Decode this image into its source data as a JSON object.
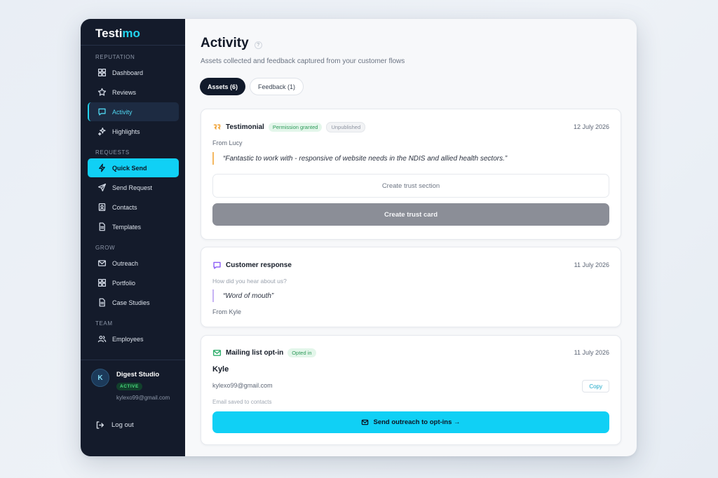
{
  "app": {
    "logo_main": "Testi",
    "logo_accent": "mo"
  },
  "sidebar": {
    "sections": [
      {
        "label": "REPUTATION"
      },
      {
        "label": "REQUESTS"
      },
      {
        "label": "GROW"
      },
      {
        "label": "TEAM"
      }
    ],
    "items": [
      {
        "label": "Dashboard",
        "icon": "grid-icon"
      },
      {
        "label": "Reviews",
        "icon": "star-icon"
      },
      {
        "label": "Activity",
        "icon": "chat-icon"
      },
      {
        "label": "Highlights",
        "icon": "sparkle-icon"
      },
      {
        "label": "Quick Send",
        "icon": "bolt-icon"
      },
      {
        "label": "Send Request",
        "icon": "send-icon"
      },
      {
        "label": "Contacts",
        "icon": "contact-icon"
      },
      {
        "label": "Templates",
        "icon": "document-icon"
      },
      {
        "label": "Outreach",
        "icon": "mail-icon"
      },
      {
        "label": "Portfolio",
        "icon": "grid-icon"
      },
      {
        "label": "Case Studies",
        "icon": "document-icon"
      },
      {
        "label": "Employees",
        "icon": "users-icon"
      }
    ],
    "account": {
      "initial": "K",
      "name": "Digest Studio",
      "badge": "ACTIVE",
      "email": "kylexo99@gmail.com"
    },
    "logout_label": "Log out"
  },
  "main": {
    "title": "Activity",
    "help": "?",
    "subtitle": "Assets collected and feedback captured from your customer flows",
    "tabs": [
      {
        "label": "Assets (6)"
      },
      {
        "label": "Feedback (1)"
      }
    ],
    "cards": {
      "testimonial": {
        "title": "Testimonial",
        "pill_permission": "Permission granted",
        "pill_status": "Unpublished",
        "date": "12 July 2026",
        "from": "From Lucy",
        "quote": "“Fantastic to work with - responsive of website needs in the NDIS and allied health sectors.”",
        "btn_section": "Create trust section",
        "btn_card": "Create trust card"
      },
      "response": {
        "title": "Customer response",
        "date": "11 July 2026",
        "question": "How did you hear about us?",
        "quote": "“Word of mouth”",
        "from": "From Kyle"
      },
      "mailing": {
        "title": "Mailing list opt-in",
        "pill": "Opted in",
        "date": "11 July 2026",
        "name": "Kyle",
        "email": "kylexo99@gmail.com",
        "copy": "Copy",
        "note": "Email saved to contacts",
        "btn": "Send outreach to opt-ins →"
      }
    }
  },
  "colors": {
    "accent": "#10d0f5",
    "sidebar_bg": "#141b2b",
    "success": "#2e9a5a"
  }
}
